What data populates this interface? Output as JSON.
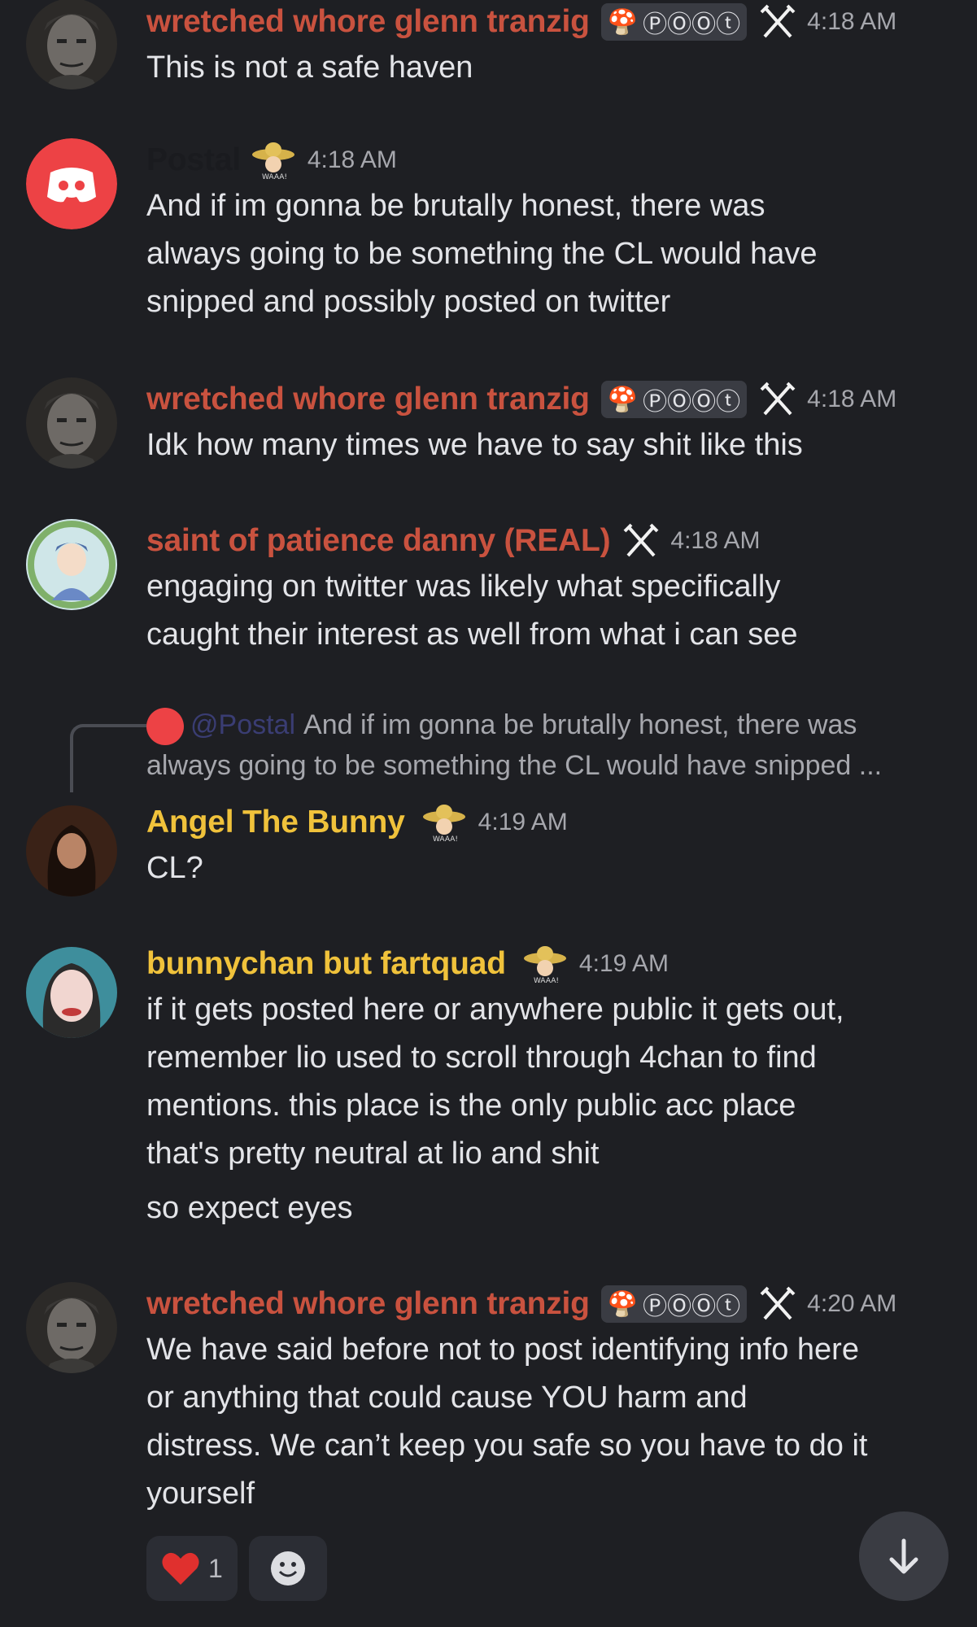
{
  "colors": {
    "background": "#1e1f23",
    "name_red": "#c9523f",
    "name_dark": "#1a1b1f",
    "name_gold": "#f0c23b",
    "discord_red": "#ed4245"
  },
  "tag": {
    "text": "ⓅⓄⓄⓣ",
    "icon": "mushroom-icon"
  },
  "messages": [
    {
      "author": "wretched whore glenn tranzig",
      "time": "4:18 AM",
      "lines": [
        "This is not a safe haven"
      ]
    },
    {
      "author": "Postal",
      "time": "4:18 AM",
      "lines": [
        "And if im gonna be brutally honest, there was",
        "always going to be something the CL would have",
        "snipped and possibly posted on twitter"
      ]
    },
    {
      "author": "wretched whore glenn tranzig",
      "time": "4:18 AM",
      "lines": [
        "Idk how many times we have to say shit like this"
      ]
    },
    {
      "author": "saint of patience danny (REAL)",
      "time": "4:18 AM",
      "lines": [
        "engaging on twitter was likely what specifically",
        "caught their interest as well from what i can see"
      ]
    },
    {
      "author": "Angel The Bunny",
      "time": "4:19 AM",
      "lines": [
        "CL?"
      ]
    },
    {
      "author": "bunnychan but fartquad",
      "time": "4:19 AM",
      "lines": [
        "if it gets posted here or anywhere public it gets out,",
        "remember lio used to scroll through 4chan to find",
        "mentions. this place is the only public acc place",
        "that's pretty neutral at lio and shit"
      ],
      "extra": "so expect eyes"
    },
    {
      "author": "wretched whore glenn tranzig",
      "time": "4:20 AM",
      "lines": [
        "We have said before not to post identifying info here",
        "or anything that could cause YOU harm and",
        "distress. We can’t keep you safe so you have to do it",
        "yourself"
      ]
    }
  ],
  "reply": {
    "mention": "@Postal",
    "line1": "And if im gonna be brutally honest, there was",
    "line2": "always going to be something the CL would have snipped ..."
  },
  "reactions": [
    {
      "emoji": "heart-icon",
      "count": "1"
    }
  ]
}
